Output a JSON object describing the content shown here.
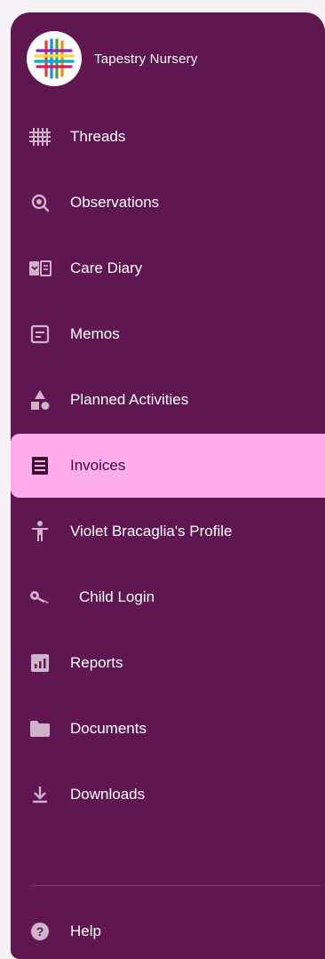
{
  "brand": {
    "name": "Tapestry Nursery"
  },
  "nav": {
    "items": [
      {
        "label": "Threads",
        "icon": "grid-icon"
      },
      {
        "label": "Observations",
        "icon": "observation-icon"
      },
      {
        "label": "Care Diary",
        "icon": "book-icon"
      },
      {
        "label": "Memos",
        "icon": "memo-icon"
      },
      {
        "label": "Planned Activities",
        "icon": "shapes-icon"
      },
      {
        "label": "Invoices",
        "icon": "invoice-icon",
        "active": true
      },
      {
        "label": "Violet Bracaglia's Profile",
        "icon": "person-icon"
      },
      {
        "label": "Child Login",
        "icon": "key-icon"
      },
      {
        "label": "Reports",
        "icon": "report-icon"
      },
      {
        "label": "Documents",
        "icon": "folder-icon"
      },
      {
        "label": "Downloads",
        "icon": "download-icon"
      }
    ]
  },
  "help": {
    "label": "Help",
    "icon": "help-icon"
  },
  "colors": {
    "sidebar_bg": "#601650",
    "active_bg": "#ffacef",
    "page_bg": "#f6f2f6"
  }
}
